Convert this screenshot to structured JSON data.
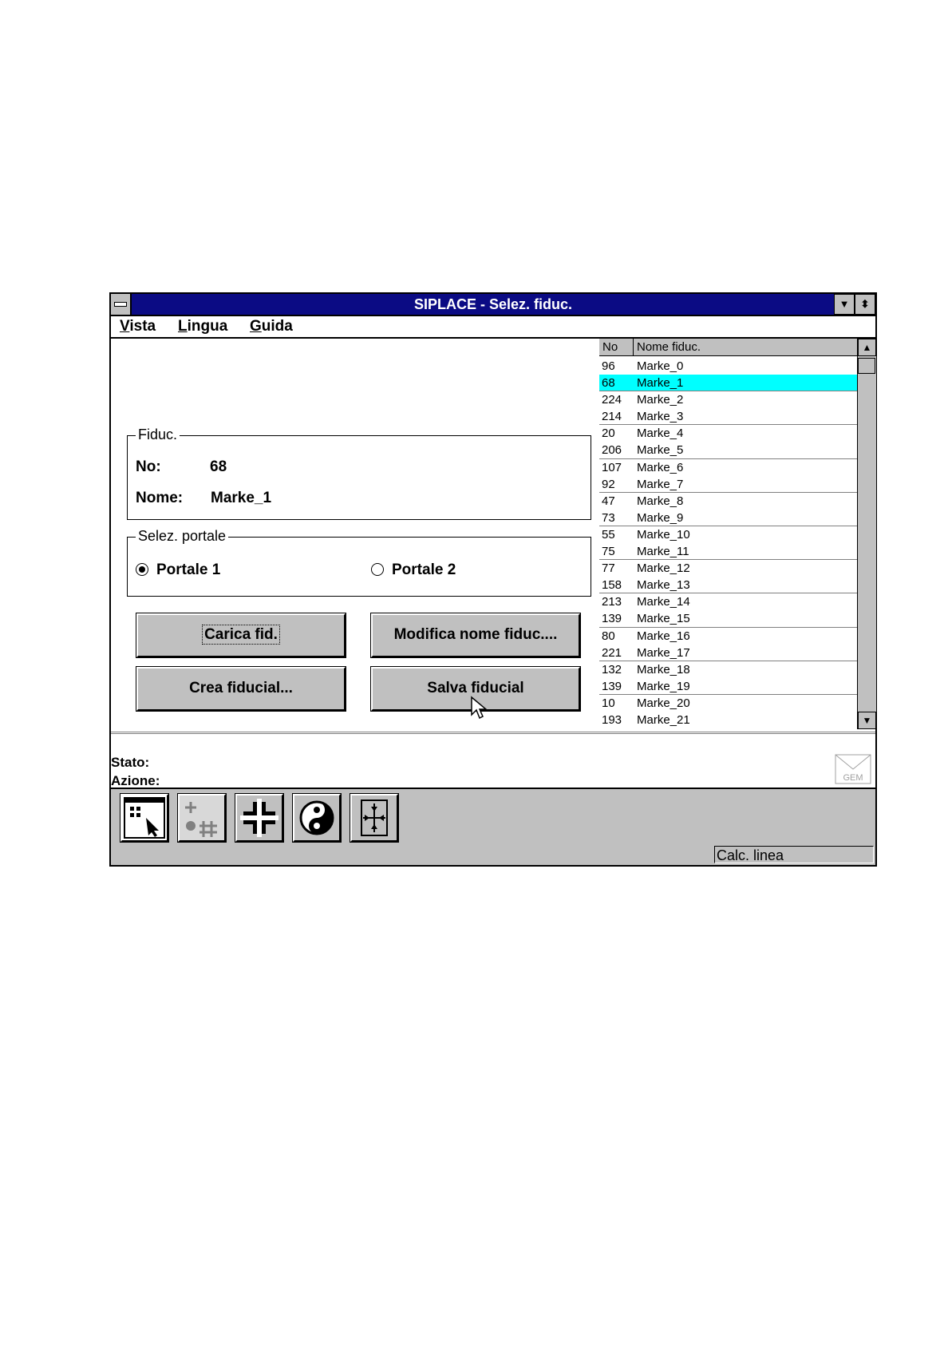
{
  "window": {
    "title": "SIPLACE - Selez. fiduc."
  },
  "menu": [
    {
      "accel": "V",
      "rest": "ista"
    },
    {
      "accel": "L",
      "rest": "ingua"
    },
    {
      "accel": "G",
      "rest": "uida"
    }
  ],
  "fiducial": {
    "legend": "Fiduc.",
    "no_label": "No:",
    "no_value": "68",
    "name_label": "Nome:",
    "name_value": "Marke_1"
  },
  "gantry": {
    "legend": "Selez. portale",
    "option1": "Portale 1",
    "option2": "Portale 2",
    "selected": "Portale 1"
  },
  "buttons": {
    "load": "Carica fid.",
    "rename": "Modifica nome fiduc....",
    "create": "Crea fiducial...",
    "save": "Salva fiducial"
  },
  "list": {
    "col_no": "No",
    "col_name": "Nome fiduc.",
    "selected_index": 1,
    "rows": [
      {
        "no": "96",
        "name": "Marke_0"
      },
      {
        "no": "68",
        "name": "Marke_1"
      },
      {
        "no": "224",
        "name": "Marke_2"
      },
      {
        "no": "214",
        "name": "Marke_3"
      },
      {
        "no": "20",
        "name": "Marke_4"
      },
      {
        "no": "206",
        "name": "Marke_5"
      },
      {
        "no": "107",
        "name": "Marke_6"
      },
      {
        "no": "92",
        "name": "Marke_7"
      },
      {
        "no": "47",
        "name": "Marke_8"
      },
      {
        "no": "73",
        "name": "Marke_9"
      },
      {
        "no": "55",
        "name": "Marke_10"
      },
      {
        "no": "75",
        "name": "Marke_11"
      },
      {
        "no": "77",
        "name": "Marke_12"
      },
      {
        "no": "158",
        "name": "Marke_13"
      },
      {
        "no": "213",
        "name": "Marke_14"
      },
      {
        "no": "139",
        "name": "Marke_15"
      },
      {
        "no": "80",
        "name": "Marke_16"
      },
      {
        "no": "221",
        "name": "Marke_17"
      },
      {
        "no": "132",
        "name": "Marke_18"
      },
      {
        "no": "139",
        "name": "Marke_19"
      },
      {
        "no": "10",
        "name": "Marke_20"
      },
      {
        "no": "193",
        "name": "Marke_21"
      }
    ]
  },
  "status": {
    "stato_label": "Stato:",
    "azione_label": "Azione:",
    "gem_label": "GEM"
  },
  "toolbar": {
    "icons": [
      "select-arrow-icon",
      "fiducial-grid-icon",
      "cross-move-icon",
      "yin-yang-icon",
      "center-align-icon"
    ]
  },
  "statusbar": {
    "calc": "Calc. linea"
  },
  "colors": {
    "title_bg": "#0b0b84",
    "selection": "#00ffff",
    "face": "#c0c0c0"
  }
}
